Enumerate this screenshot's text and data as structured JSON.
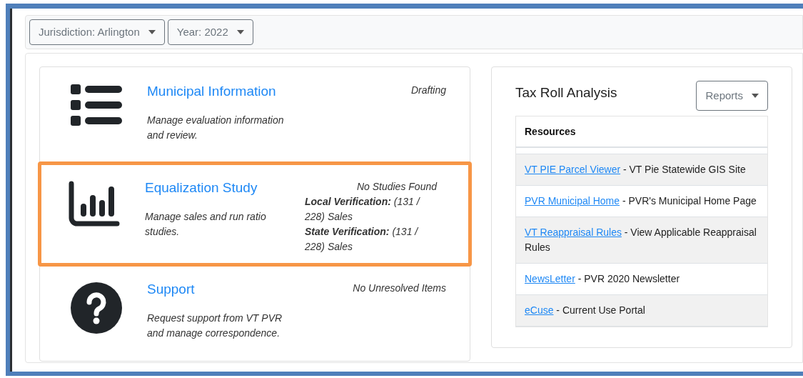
{
  "filters": [
    {
      "label": "Jurisdiction: Arlington"
    },
    {
      "label": "Year: 2022"
    }
  ],
  "modules": [
    {
      "kind": "list",
      "title": "Municipal Information",
      "description": "Manage evaluation information and review.",
      "highlighted": false,
      "status": [
        {
          "value": "Drafting"
        }
      ]
    },
    {
      "kind": "chart",
      "title": "Equalization Study",
      "description": "Manage sales and run ratio studies.",
      "highlighted": true,
      "status": [
        {
          "value": "No Studies Found"
        },
        {
          "label": "Local Verification:",
          "value": "(131 / 228) Sales"
        },
        {
          "label": "State Verification:",
          "value": "(131 / 228) Sales"
        }
      ]
    },
    {
      "kind": "help",
      "title": "Support",
      "description": "Request support from VT PVR and manage correspondence.",
      "highlighted": false,
      "status": [
        {
          "value": "No Unresolved Items"
        }
      ]
    }
  ],
  "tax_roll": {
    "title": "Tax Roll Analysis",
    "reports_button": "Reports",
    "table_header": "Resources",
    "rows": [
      {
        "link": "VT PIE Parcel Viewer",
        "text": "- VT Pie Statewide GIS Site"
      },
      {
        "link": "PVR Municipal Home",
        "text": "- PVR's Municipal Home Page"
      },
      {
        "link": "VT Reappraisal Rules",
        "text": "- View Applicable Reappraisal Rules"
      },
      {
        "link": "NewsLetter",
        "text": "- PVR 2020 Newsletter"
      },
      {
        "link": "eCuse",
        "text": "- Current Use Portal"
      }
    ]
  }
}
